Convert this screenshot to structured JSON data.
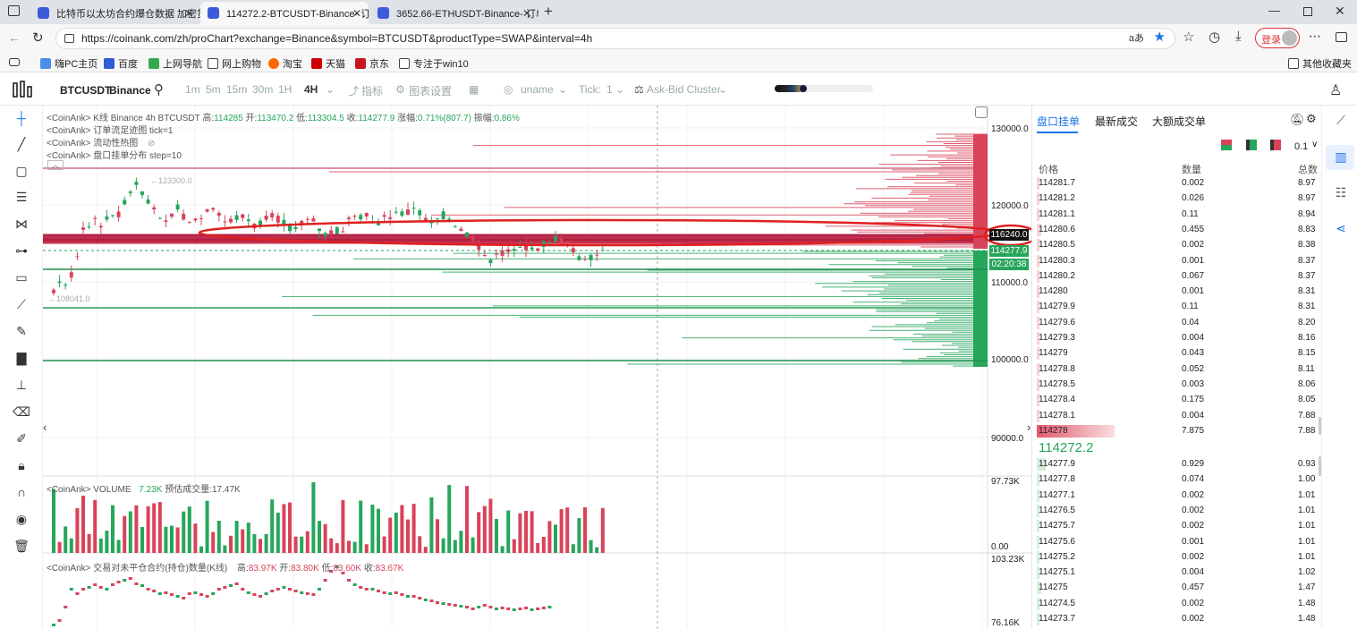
{
  "tabs": [
    {
      "title": "比特币以太坊合约爆仓数据 加密货"
    },
    {
      "title": "114272.2-BTCUSDT-Binance- 订单"
    },
    {
      "title": "3652.66-ETHUSDT-Binance- 订单"
    }
  ],
  "address": {
    "url": "https://coinank.com/zh/proChart?exchange=Binance&symbol=BTCUSDT&productType=SWAP&interval=4h",
    "read_aloud": "aあ",
    "login": "登录"
  },
  "bookmarks": [
    "嗨PC主页",
    "百度",
    "上网导航",
    "网上购物",
    "淘宝",
    "天猫",
    "京东",
    "专注于win10"
  ],
  "bookmarks_other": "其他收藏夹",
  "toolbar": {
    "symbol": "BTCUSDT",
    "exchange": "Binance",
    "intervals": [
      "1m",
      "5m",
      "15m",
      "30m",
      "1H",
      "4H"
    ],
    "indicator": "指标",
    "chart_settings": "图表设置",
    "user": "uname",
    "tick_label": "Tick:",
    "tick_value": "1",
    "cluster": "Ask-Bid Cluster"
  },
  "legends": {
    "kline": "<CoinAnk> K线  Binance 4h BTCUSDT",
    "high_lbl": "高:",
    "high": "114285",
    "open_lbl": "开:",
    "open": "113470.2",
    "low_lbl": "低:",
    "low": "113304.5",
    "close_lbl": "收:",
    "close": "114277.9",
    "chg_lbl": "涨幅:",
    "chg": "0.71%(807.7)",
    "amp_lbl": "振幅:",
    "amp": "0.86%",
    "footprint": "<CoinAnk> 订单流足迹图   tick=1",
    "heatmap": "<CoinAnk> 流动性热图",
    "depth": "<CoinAnk> 盘口挂单分布   step=10",
    "volume": "<CoinAnk> VOLUME",
    "vol_value": "7.23K",
    "vol_est": "预估成交量:17.47K",
    "oi": "<CoinAnk> 交易对未平仓合约(持仓)数量(K线)",
    "oi_high_lbl": "高:",
    "oi_high": "83.97K",
    "oi_open_lbl": "开:",
    "oi_open": "83.80K",
    "oi_low_lbl": "低:",
    "oi_low": "83.60K",
    "oi_close_lbl": "收:",
    "oi_close": "83.67K"
  },
  "annotations": {
    "max": "←123300.0",
    "min": "←108041.0"
  },
  "price_axis": {
    "ticks": [
      "130000.0",
      "120000.0",
      "110000.0",
      "100000.0",
      "90000.0"
    ],
    "marked_price": "116240.0",
    "last_price": "114277.9",
    "countdown": "02:20:38",
    "vol_ticks": [
      "97.73K",
      "0.00"
    ],
    "oi_ticks": [
      "103.23K",
      "76.16K"
    ]
  },
  "orderbook": {
    "tabs": [
      "盘口挂单",
      "最新成交",
      "大额成交单"
    ],
    "step": "0.1",
    "headers": [
      "价格",
      "数量",
      "总数"
    ],
    "asks": [
      {
        "price": "114281.7",
        "qty": "0.002",
        "total": "8.97"
      },
      {
        "price": "114281.2",
        "qty": "0.026",
        "total": "8.97"
      },
      {
        "price": "114281.1",
        "qty": "0.11",
        "total": "8.94"
      },
      {
        "price": "114280.6",
        "qty": "0.455",
        "total": "8.83"
      },
      {
        "price": "114280.5",
        "qty": "0.002",
        "total": "8.38"
      },
      {
        "price": "114280.3",
        "qty": "0.001",
        "total": "8.37"
      },
      {
        "price": "114280.2",
        "qty": "0.067",
        "total": "8.37"
      },
      {
        "price": "114280",
        "qty": "0.001",
        "total": "8.31"
      },
      {
        "price": "114279.9",
        "qty": "0.11",
        "total": "8.31"
      },
      {
        "price": "114279.6",
        "qty": "0.04",
        "total": "8.20"
      },
      {
        "price": "114279.3",
        "qty": "0.004",
        "total": "8.16"
      },
      {
        "price": "114279",
        "qty": "0.043",
        "total": "8.15"
      },
      {
        "price": "114278.8",
        "qty": "0.052",
        "total": "8.11"
      },
      {
        "price": "114278.5",
        "qty": "0.003",
        "total": "8.06"
      },
      {
        "price": "114278.4",
        "qty": "0.175",
        "total": "8.05"
      },
      {
        "price": "114278.1",
        "qty": "0.004",
        "total": "7.88"
      },
      {
        "price": "114278",
        "qty": "7.875",
        "total": "7.88"
      }
    ],
    "mid": "114272.2",
    "bids": [
      {
        "price": "114277.9",
        "qty": "0.929",
        "total": "0.93"
      },
      {
        "price": "114277.8",
        "qty": "0.074",
        "total": "1.00"
      },
      {
        "price": "114277.1",
        "qty": "0.002",
        "total": "1.01"
      },
      {
        "price": "114276.5",
        "qty": "0.002",
        "total": "1.01"
      },
      {
        "price": "114275.7",
        "qty": "0.002",
        "total": "1.01"
      },
      {
        "price": "114275.6",
        "qty": "0.001",
        "total": "1.01"
      },
      {
        "price": "114275.2",
        "qty": "0.002",
        "total": "1.01"
      },
      {
        "price": "114275.1",
        "qty": "0.004",
        "total": "1.02"
      },
      {
        "price": "114275",
        "qty": "0.457",
        "total": "1.47"
      },
      {
        "price": "114274.5",
        "qty": "0.002",
        "total": "1.48"
      },
      {
        "price": "114273.7",
        "qty": "0.002",
        "total": "1.48"
      }
    ]
  },
  "colors": {
    "up": "#26a65b",
    "down": "#d9435a",
    "ask_bg": "#f5c6cc",
    "bid_bg": "#c7ecd3",
    "accent": "#1a73e8",
    "circle": "#e02020"
  }
}
